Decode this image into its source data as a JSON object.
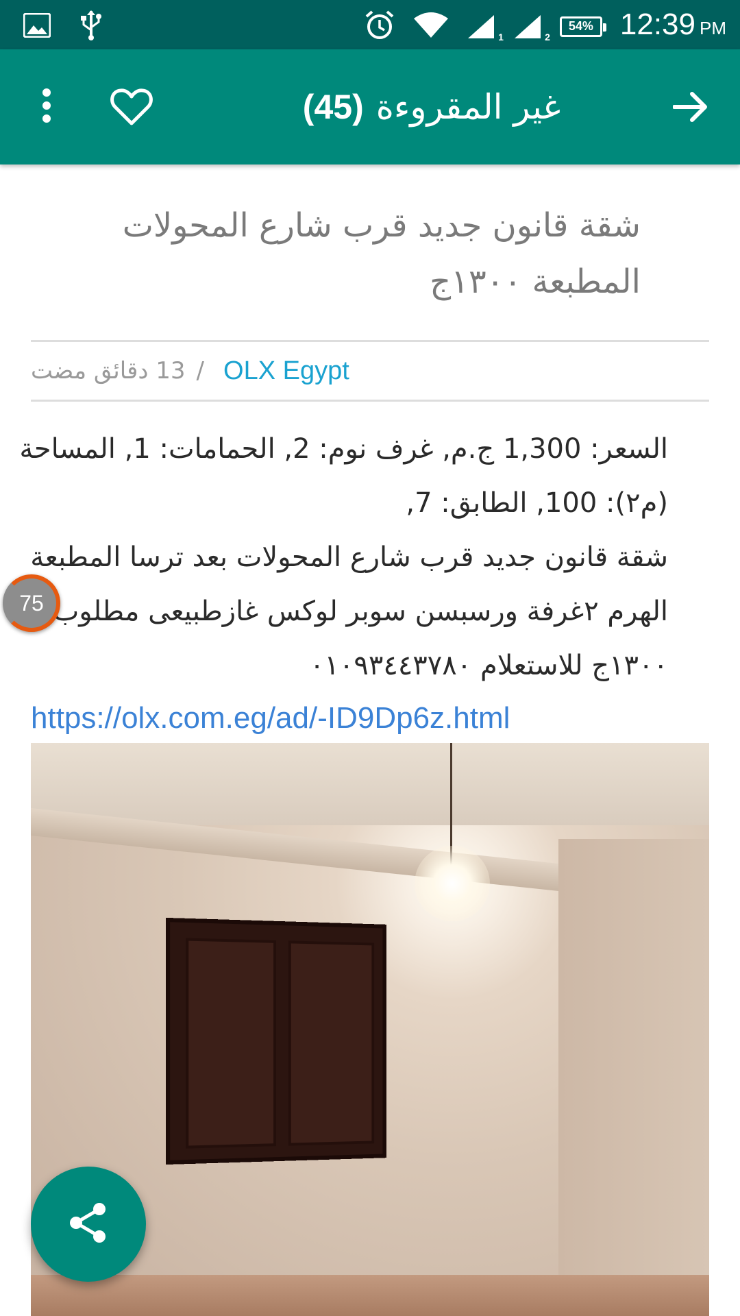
{
  "status_bar": {
    "time": "12:39",
    "ampm": "PM",
    "battery": "54%",
    "sim1": "1",
    "sim2": "2",
    "icons": [
      "image-icon",
      "usb-icon",
      "alarm-icon",
      "wifi-icon",
      "signal-icon",
      "signal-icon",
      "battery-icon"
    ]
  },
  "app_bar": {
    "title": "غير المقروءة",
    "count": "(45)",
    "icons": [
      "more-vert-icon",
      "heart-icon",
      "arrow-forward-icon"
    ],
    "color": "#00897b"
  },
  "post": {
    "title": "شقة قانون جديد قرب شارع المحولات المطبعة ١٣٠٠ج",
    "source": "OLX Egypt",
    "separator": "/",
    "time_ago": "13 دقائق مضت",
    "description_lines": [
      "السعر: 1,300 ج.م, غرف نوم: 2, الحمامات: 1, المساحة",
      "(م٢): 100, الطابق: 7,",
      "شقة قانون جديد قرب شارع المحولات بعد ترسا المطبعة",
      "الهرم ٢غرفة ورسبسن سوبر لوكس غازطبيعى مطلوب",
      "١٣٠٠ج للاستعلام ٠١٠٩٣٤٤٣٧٨٠"
    ],
    "link": "https://olx.com.eg/ad/-ID9Dp6z.html"
  },
  "bubble": {
    "value": "75"
  },
  "fab": {
    "icon": "share-icon"
  }
}
